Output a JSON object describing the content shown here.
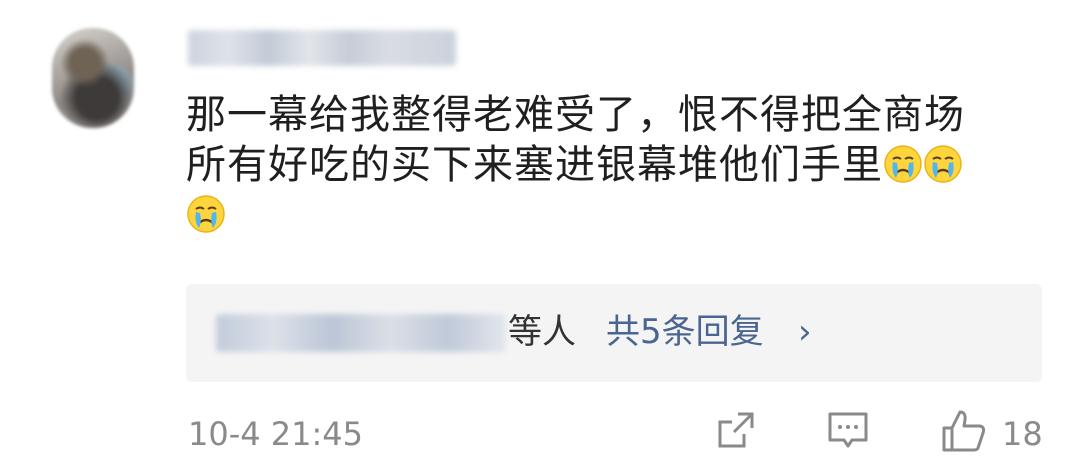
{
  "comment": {
    "text_line1": "那一幕给我整得老难受了，恨不得把全商场",
    "text_line2": "所有好吃的买下来塞进银幕堆他们手里",
    "emojis": [
      "crying-face-emoji",
      "crying-face-emoji",
      "crying-face-emoji"
    ],
    "timestamp": "10-4 21:45",
    "likes": "18"
  },
  "replies": {
    "suffix": "等人",
    "count_label": "共5条回复",
    "chevron": "›"
  },
  "icons": {
    "share": "share-icon",
    "comment": "comment-icon",
    "like": "thumbs-up-icon"
  },
  "colors": {
    "link": "#4a6590",
    "meta": "#8a8a8a",
    "reply_bg": "#f4f4f4"
  }
}
